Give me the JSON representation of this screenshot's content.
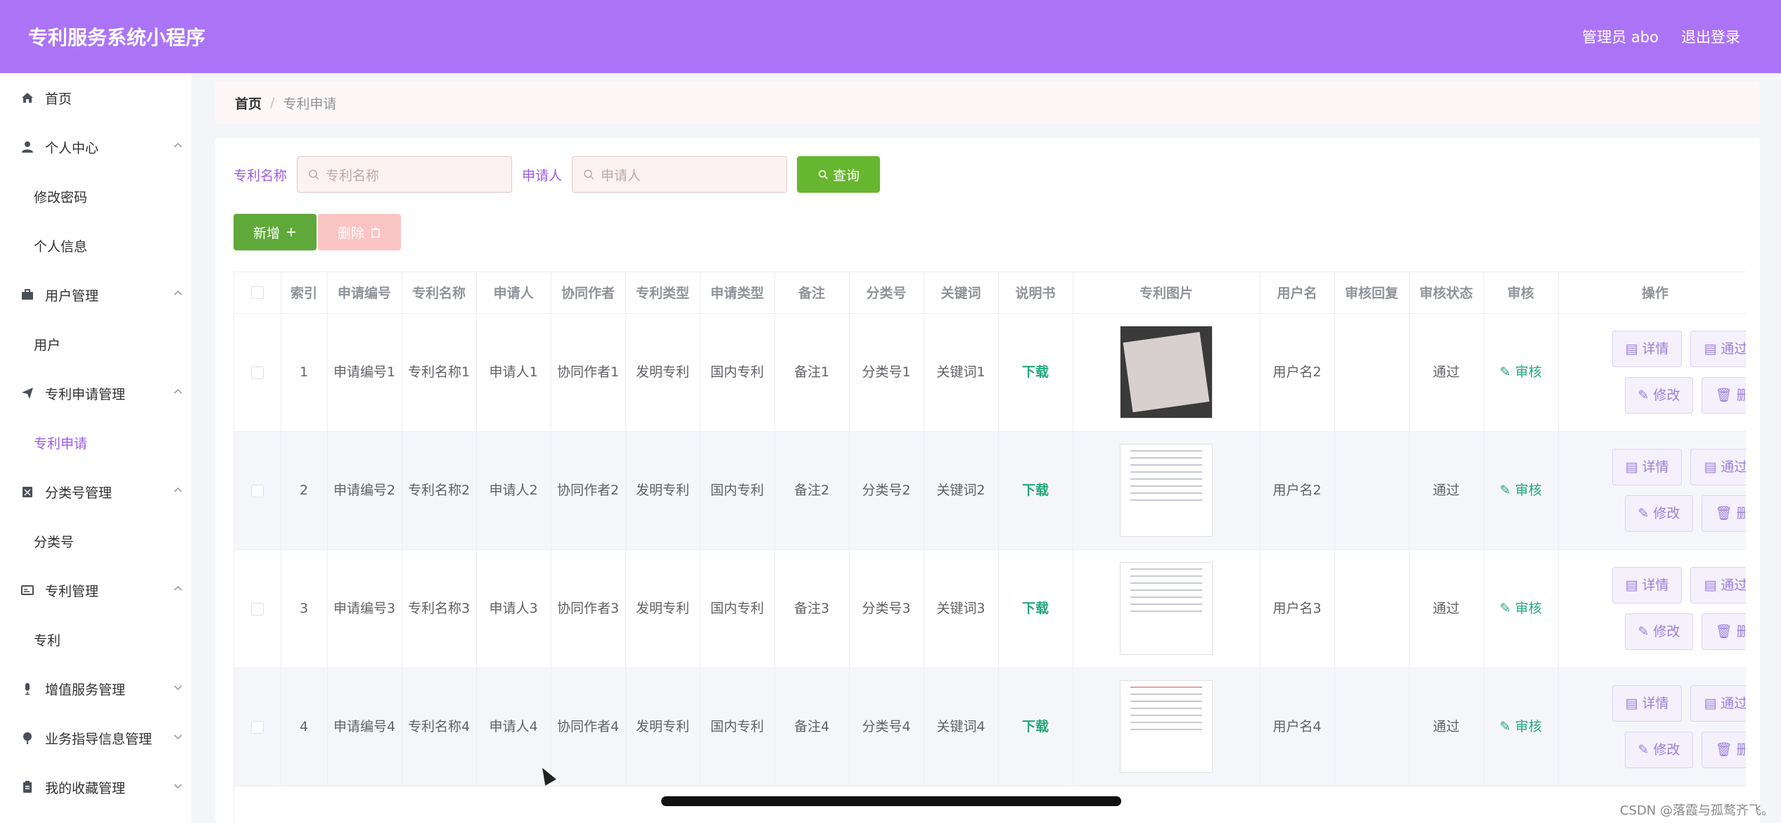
{
  "header": {
    "brand": "专利服务系统小程序",
    "admin": "管理员 abo",
    "logout": "退出登录"
  },
  "sidebar": {
    "items": [
      {
        "label": "首页",
        "icon": "home-icon"
      },
      {
        "label": "个人中心",
        "icon": "user-icon",
        "expanded": true,
        "children": [
          "修改密码",
          "个人信息"
        ]
      },
      {
        "label": "用户管理",
        "icon": "briefcase-icon",
        "expanded": true,
        "children": [
          "用户"
        ]
      },
      {
        "label": "专利申请管理",
        "icon": "send-icon",
        "expanded": true,
        "children": [
          "专利申请"
        ]
      },
      {
        "label": "分类号管理",
        "icon": "box-icon",
        "expanded": true,
        "children": [
          "分类号"
        ]
      },
      {
        "label": "专利管理",
        "icon": "card-icon",
        "expanded": true,
        "children": [
          "专利"
        ]
      },
      {
        "label": "增值服务管理",
        "icon": "mic-icon",
        "expanded": false
      },
      {
        "label": "业务指导信息管理",
        "icon": "pin-icon",
        "expanded": false
      },
      {
        "label": "我的收藏管理",
        "icon": "clipboard-icon",
        "expanded": false
      }
    ]
  },
  "breadcrumb": {
    "home": "首页",
    "sep": "/",
    "current": "专利申请"
  },
  "search": {
    "label1": "专利名称",
    "placeholder1": "专利名称",
    "label2": "申请人",
    "placeholder2": "申请人",
    "query": "查询"
  },
  "actions": {
    "add": "新增",
    "delete": "删除"
  },
  "table": {
    "headers": [
      "索引",
      "申请编号",
      "专利名称",
      "申请人",
      "协同作者",
      "专利类型",
      "申请类型",
      "备注",
      "分类号",
      "关键词",
      "说明书",
      "专利图片",
      "用户名",
      "审核回复",
      "审核状态",
      "审核",
      "操作"
    ],
    "rows": [
      {
        "idx": "1",
        "app_no": "申请编号1",
        "name": "专利名称1",
        "applicant": "申请人1",
        "coauthor": "协同作者1",
        "ptype": "发明专利",
        "atype": "国内专利",
        "note": "备注1",
        "cls": "分类号1",
        "kw": "关键词1",
        "doc": "下载",
        "user": "用户名2",
        "reply": "",
        "status": "通过",
        "audit": "审核"
      },
      {
        "idx": "2",
        "app_no": "申请编号2",
        "name": "专利名称2",
        "applicant": "申请人2",
        "coauthor": "协同作者2",
        "ptype": "发明专利",
        "atype": "国内专利",
        "note": "备注2",
        "cls": "分类号2",
        "kw": "关键词2",
        "doc": "下载",
        "user": "用户名2",
        "reply": "",
        "status": "通过",
        "audit": "审核"
      },
      {
        "idx": "3",
        "app_no": "申请编号3",
        "name": "专利名称3",
        "applicant": "申请人3",
        "coauthor": "协同作者3",
        "ptype": "发明专利",
        "atype": "国内专利",
        "note": "备注3",
        "cls": "分类号3",
        "kw": "关键词3",
        "doc": "下载",
        "user": "用户名3",
        "reply": "",
        "status": "通过",
        "audit": "审核"
      },
      {
        "idx": "4",
        "app_no": "申请编号4",
        "name": "专利名称4",
        "applicant": "申请人4",
        "coauthor": "协同作者4",
        "ptype": "发明专利",
        "atype": "国内专利",
        "note": "备注4",
        "cls": "分类号4",
        "kw": "关键词4",
        "doc": "下载",
        "user": "用户名4",
        "reply": "",
        "status": "通过",
        "audit": "审核"
      }
    ],
    "op_labels": {
      "detail": "详情",
      "pass": "通过",
      "edit": "修改",
      "del": "删"
    }
  },
  "watermark": "CSDN @落霞与孤鹜齐飞。",
  "colors": {
    "header": "#ab74f7",
    "accent": "#9b5de5",
    "green": "#67b62f",
    "teal": "#24a87a"
  }
}
